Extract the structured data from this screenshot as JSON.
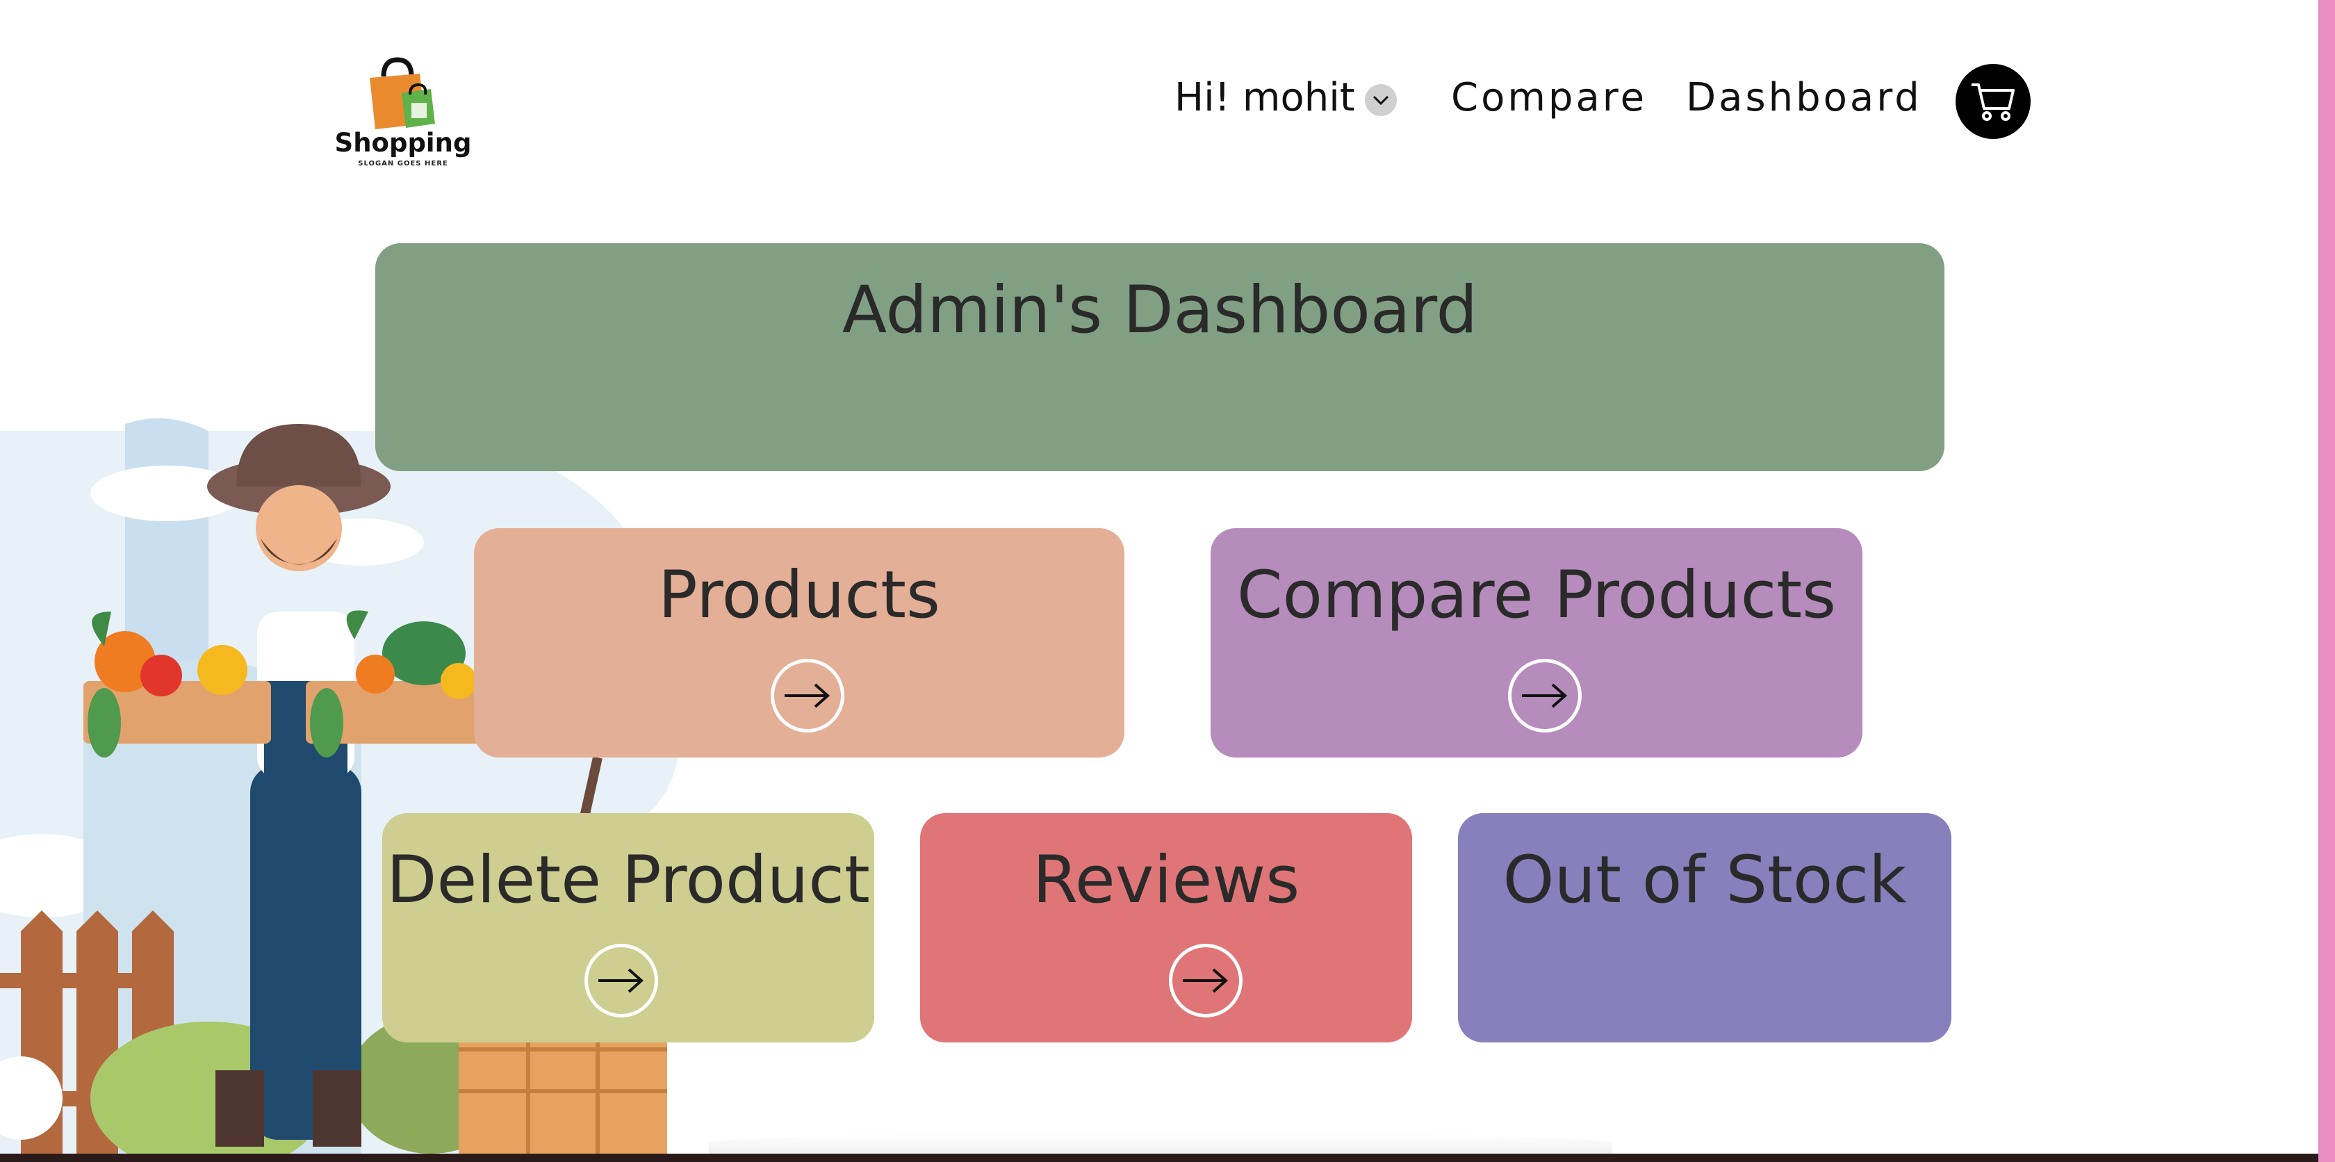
{
  "header": {
    "logo_text": "Shopping",
    "logo_slogan": "SLOGAN GOES HERE",
    "user_greeting": "Hi! mohit",
    "nav": {
      "compare": "Compare",
      "dashboard": "Dashboard"
    }
  },
  "hero": {
    "title": "Admin's Dashboard",
    "color": "#819f83"
  },
  "cards": [
    {
      "title": "Products",
      "color": "#e4af97",
      "has_arrow": true
    },
    {
      "title": "Compare Products",
      "color": "#b58cbb",
      "has_arrow": true
    },
    {
      "title": "Delete Product",
      "color": "#cdce8f",
      "has_arrow": true
    },
    {
      "title": "Reviews",
      "color": "#e07577",
      "has_arrow": true
    },
    {
      "title": "Out of Stock",
      "color": "#8780bd",
      "has_arrow": false
    }
  ],
  "icons": {
    "logo": "shopping-bag-logo-icon",
    "user_menu": "chevron-down-icon",
    "cart": "cart-icon",
    "card_arrow": "arrow-right-icon"
  },
  "accent_colors": {
    "scrollbar": "#e98dc4",
    "bottom_bar": "#2b1a1a"
  }
}
